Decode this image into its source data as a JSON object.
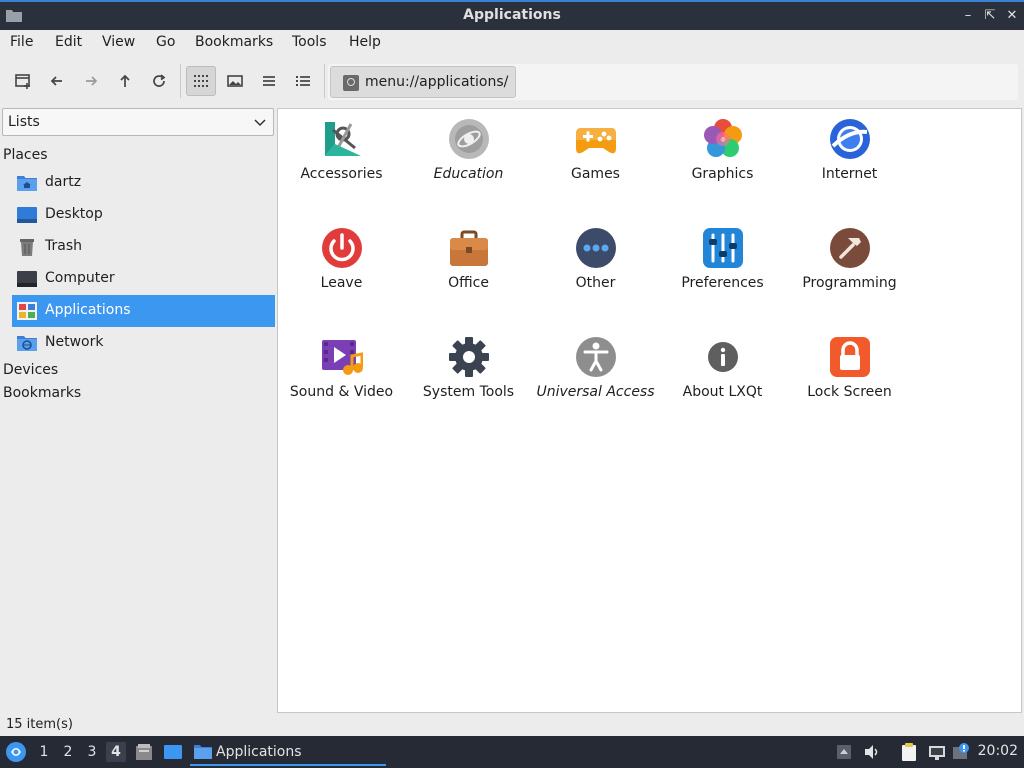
{
  "window": {
    "title": "Applications"
  },
  "menu": {
    "items": [
      "File",
      "Edit",
      "View",
      "Go",
      "Bookmarks",
      "Tools",
      "Help"
    ]
  },
  "toolbar": {
    "path": "menu://applications/",
    "buttons": [
      "new-tab-icon",
      "back-icon",
      "forward-icon",
      "up-icon",
      "reload-icon",
      "icon-view-icon",
      "thumbnail-view-icon",
      "compact-view-icon",
      "detailed-list-icon"
    ],
    "active_view": "icon-view"
  },
  "sidebar": {
    "dropdown": "Lists",
    "places_title": "Places",
    "places": [
      {
        "label": "dartz",
        "icon": "home-folder-icon"
      },
      {
        "label": "Desktop",
        "icon": "desktop-icon"
      },
      {
        "label": "Trash",
        "icon": "trash-icon"
      },
      {
        "label": "Computer",
        "icon": "computer-icon"
      },
      {
        "label": "Applications",
        "icon": "applications-icon",
        "selected": true
      },
      {
        "label": "Network",
        "icon": "network-icon"
      }
    ],
    "devices_title": "Devices",
    "bookmarks_title": "Bookmarks"
  },
  "apps": [
    {
      "label": "Accessories",
      "icon": "accessories-icon"
    },
    {
      "label": "Education",
      "icon": "education-icon",
      "italic": true
    },
    {
      "label": "Games",
      "icon": "games-icon"
    },
    {
      "label": "Graphics",
      "icon": "graphics-icon"
    },
    {
      "label": "Internet",
      "icon": "internet-icon"
    },
    {
      "label": "Leave",
      "icon": "power-icon"
    },
    {
      "label": "Office",
      "icon": "briefcase-icon"
    },
    {
      "label": "Other",
      "icon": "more-icon"
    },
    {
      "label": "Preferences",
      "icon": "preferences-icon"
    },
    {
      "label": "Programming",
      "icon": "hammer-icon"
    },
    {
      "label": "Sound & Video",
      "icon": "multimedia-icon"
    },
    {
      "label": "System Tools",
      "icon": "gear-icon"
    },
    {
      "label": "Universal Access",
      "icon": "accessibility-icon",
      "italic": true
    },
    {
      "label": "About LXQt",
      "icon": "info-icon"
    },
    {
      "label": "Lock Screen",
      "icon": "lock-icon"
    }
  ],
  "status": {
    "text": "15 item(s)"
  },
  "taskbar": {
    "workspaces": [
      "1",
      "2",
      "3",
      "4"
    ],
    "current_workspace": "4",
    "task": "Applications",
    "clock": "20:02"
  },
  "colors": {
    "accent": "#3c97f0",
    "titlebar": "#2b313c",
    "taskbar": "#252a35"
  }
}
